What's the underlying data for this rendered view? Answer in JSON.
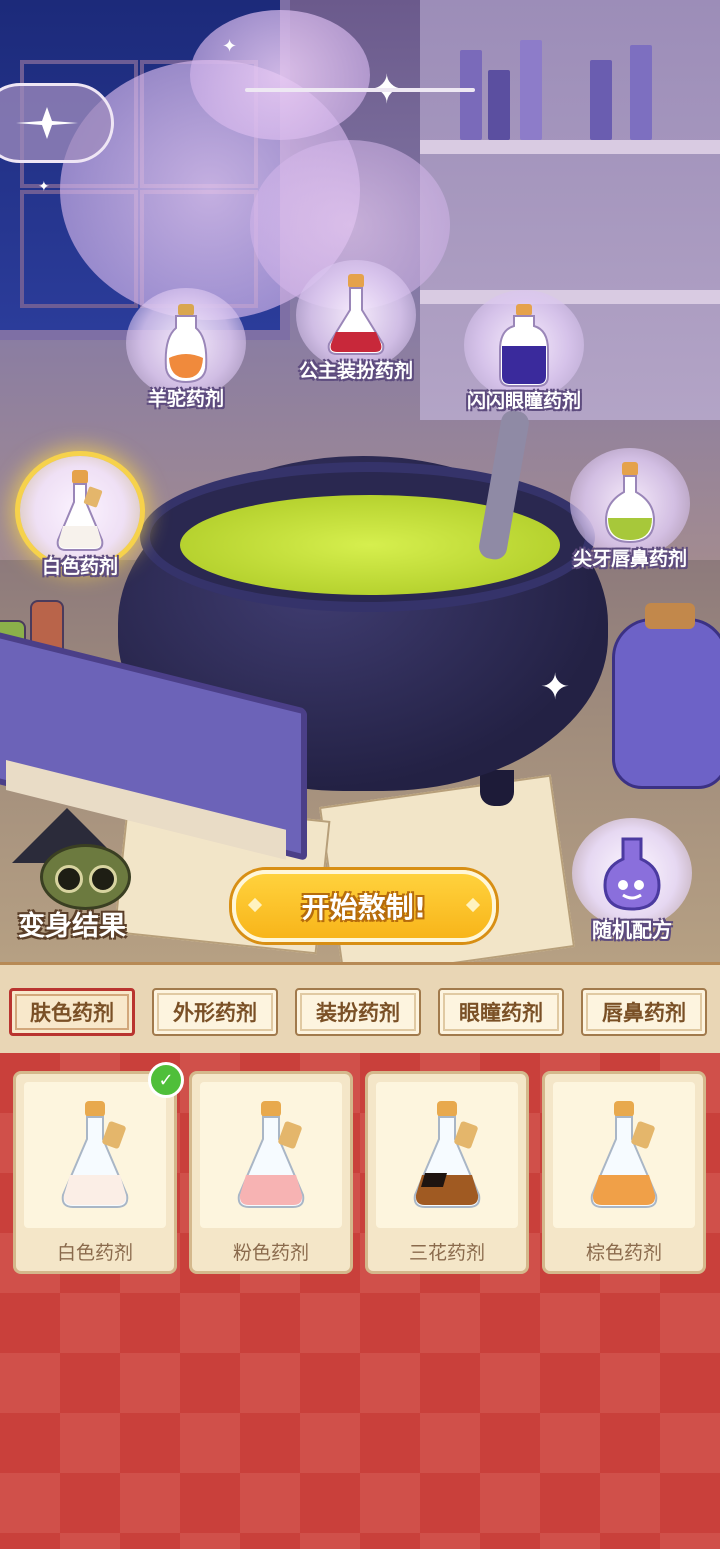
{
  "scene_potions": [
    {
      "label": "羊驼药剂",
      "liquid": "#f08a3c"
    },
    {
      "label": "公主装扮药剂",
      "liquid": "#c8283a"
    },
    {
      "label": "闪闪眼瞳药剂",
      "liquid": "#3a2a9c"
    },
    {
      "label": "白色药剂",
      "liquid": "#f7f2ec"
    },
    {
      "label": "尖牙唇鼻药剂",
      "liquid": "#a7c83a"
    }
  ],
  "result_label": "变身结果",
  "brew_button": "开始熬制!",
  "random_label": "随机配方",
  "tabs": [
    "肤色药剂",
    "外形药剂",
    "装扮药剂",
    "眼瞳药剂",
    "唇鼻药剂"
  ],
  "active_tab": "肤色药剂",
  "items": [
    {
      "name": "白色药剂",
      "liquid": "#fbeee6",
      "selected": true
    },
    {
      "name": "粉色药剂",
      "liquid": "#f7b3b3",
      "selected": false
    },
    {
      "name": "三花药剂",
      "liquid": "#a05a22",
      "selected": false
    },
    {
      "name": "棕色药剂",
      "liquid": "#f0a048",
      "selected": false
    }
  ],
  "colors": {
    "accent": "#f8b51a",
    "panel_red": "#c9403b",
    "tab_active_border": "#b9342f"
  }
}
